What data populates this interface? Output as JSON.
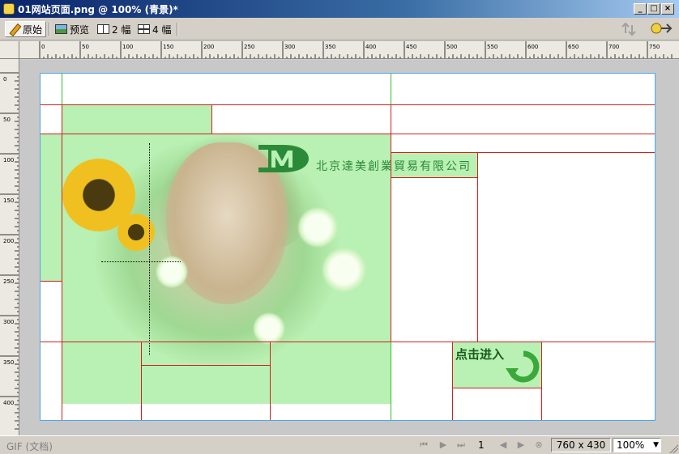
{
  "window": {
    "title": "01网站页面.png @ 100% (青景)*",
    "min_label": "_",
    "max_label": "□",
    "close_label": "×"
  },
  "toolbar": {
    "original_label": "原始",
    "preview_label": "预览",
    "split2_label": "2 幅",
    "split4_label": "4 幅"
  },
  "ruler": {
    "h_labels": [
      "0",
      "50",
      "100",
      "150",
      "200",
      "250",
      "300",
      "350",
      "400",
      "450",
      "500",
      "550",
      "600",
      "650",
      "700",
      "750"
    ],
    "v_labels": [
      "0",
      "50",
      "100",
      "150",
      "200",
      "250",
      "300",
      "350",
      "400"
    ]
  },
  "canvas_content": {
    "logo_letters": "DM",
    "company_name": "北京達美創業貿易有限公司",
    "enter_label": "点击进入"
  },
  "statusbar": {
    "file_info": "GIF (文档)",
    "frame_number": "1",
    "image_size": "760 x 430",
    "zoom": "100%"
  },
  "colors": {
    "slice_line": "#d02020",
    "guide_line": "#30c030",
    "slice_fill": "#b9f0b3",
    "brand_green": "#2b8a3a"
  }
}
